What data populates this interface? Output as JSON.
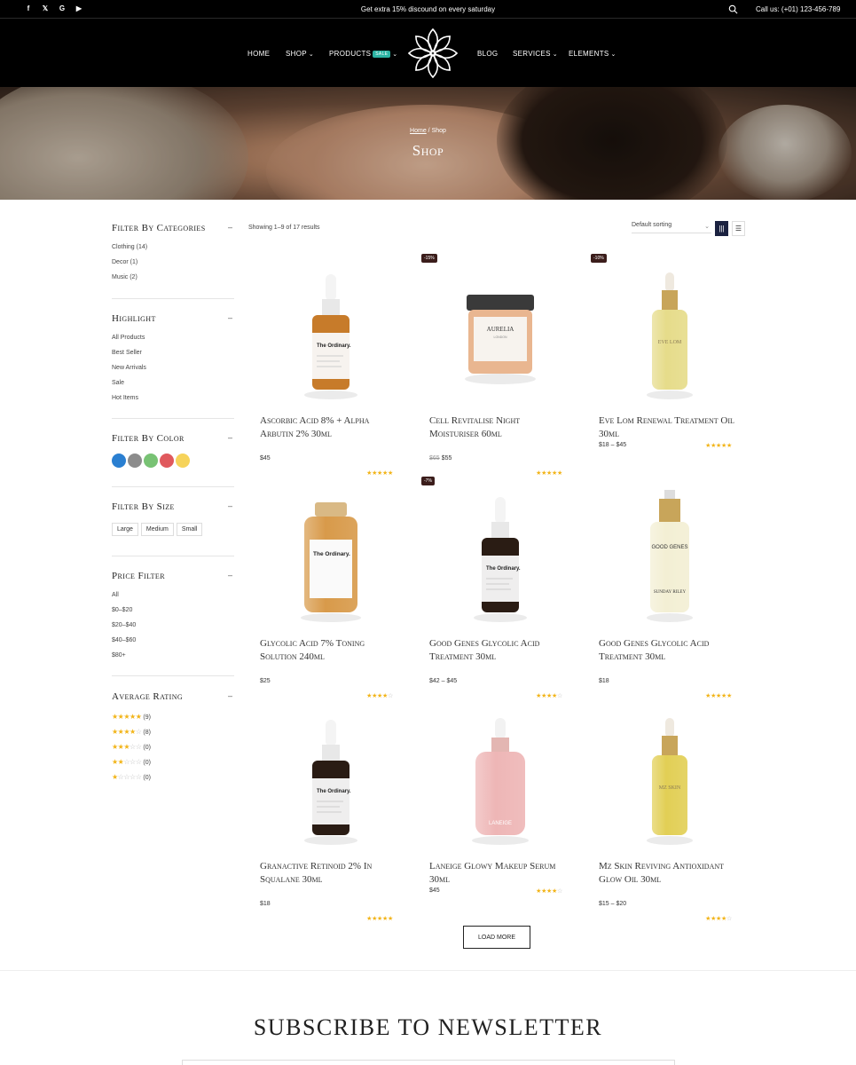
{
  "topbar": {
    "promo": "Get extra 15% discound on every saturday",
    "call": "Call us: (+01) 123-456-789",
    "socials": [
      {
        "icon": "facebook-icon",
        "glyph": "f"
      },
      {
        "icon": "x-icon",
        "glyph": "𝕏"
      },
      {
        "icon": "google-icon",
        "glyph": "G"
      },
      {
        "icon": "youtube-icon",
        "glyph": "▶"
      }
    ]
  },
  "nav": {
    "home": "HOME",
    "shop": "SHOP",
    "products": "PRODUCTS",
    "sale_badge": "SALE",
    "blog": "BLOG",
    "services": "SERVICES",
    "elements": "ELEMENTS"
  },
  "hero": {
    "breadcrumb_home": "Home",
    "breadcrumb_sep": " / ",
    "breadcrumb_current": "Shop",
    "title": "Shop"
  },
  "sidebar": {
    "categories": {
      "title": "Filter By Categories",
      "toggle": "–",
      "items": [
        "Clothing (14)",
        "Decor (1)",
        "Music (2)"
      ]
    },
    "highlight": {
      "title": "Highlight",
      "toggle": "–",
      "items": [
        "All Products",
        "Best Seller",
        "New Arrivals",
        "Sale",
        "Hot Items"
      ]
    },
    "color": {
      "title": "Filter By Color",
      "toggle": "–",
      "swatches": [
        "#2a7fd1",
        "#8c8c8c",
        "#78c274",
        "#e0595d",
        "#f6d35a"
      ]
    },
    "size": {
      "title": "Filter By Size",
      "toggle": "–",
      "items": [
        "Large",
        "Medium",
        "Small"
      ]
    },
    "price": {
      "title": "Price Filter",
      "toggle": "–",
      "items": [
        "All",
        "$0–$20",
        "$20–$40",
        "$40–$60",
        "$80+"
      ]
    },
    "rating": {
      "title": "Average Rating",
      "toggle": "–",
      "items": [
        {
          "stars": 5,
          "count": "(9)"
        },
        {
          "stars": 4,
          "count": "(8)"
        },
        {
          "stars": 3,
          "count": "(0)"
        },
        {
          "stars": 2,
          "count": "(0)"
        },
        {
          "stars": 1,
          "count": "(0)"
        }
      ]
    }
  },
  "toolbar": {
    "showing": "Showing 1–9 of 17 results",
    "sort": "Default sorting"
  },
  "products": [
    {
      "title": "Ascorbic Acid 8% + Alpha Arbutin 2% 30ml",
      "price": "$45",
      "old_price": "",
      "badge": "",
      "rating": 5
    },
    {
      "title": "Cell Revitalise Night Moisturiser 60ml",
      "price": "$55",
      "old_price": "$65",
      "badge": "-15%",
      "rating": 5
    },
    {
      "title": "Eve Lom Renewal Treatment Oil 30ml",
      "price": "$18 – $45",
      "old_price": "",
      "badge": "-10%",
      "rating": 5
    },
    {
      "title": "Glycolic Acid 7% Toning Solution 240ml",
      "price": "$25",
      "old_price": "",
      "badge": "",
      "rating": 4
    },
    {
      "title": "Good Genes Glycolic Acid Treatment 30ml",
      "price": "$42 – $45",
      "old_price": "",
      "badge": "-7%",
      "rating": 4
    },
    {
      "title": "Good Genes Glycolic Acid Treatment 30ml",
      "price": "$18",
      "old_price": "",
      "badge": "",
      "rating": 5
    },
    {
      "title": "Granactive Retinoid 2% In Squalane 30ml",
      "price": "$18",
      "old_price": "",
      "badge": "",
      "rating": 5
    },
    {
      "title": "Laneige Glowy Makeup Serum 30ml",
      "price": "$45",
      "old_price": "",
      "badge": "",
      "rating": 4
    },
    {
      "title": "Mz Skin Reviving Antioxidant Glow Oil 30ml",
      "price": "$15 – $20",
      "old_price": "",
      "badge": "",
      "rating": 4
    }
  ],
  "product_labels": {
    "ordinary": "The Ordinary.",
    "aurelia": "AURELIA",
    "aurelia_sub": "LONDON",
    "evelom": "EVE LOM",
    "goodgenes": "GOOD GENES",
    "sundayriley": "SUNDAY RILEY",
    "laneige": "LANEIGE",
    "mzskin": "MZ SKIN"
  },
  "load_more": "LOAD MORE",
  "newsletter": {
    "title": "SUBSCRIBE TO NEWSLETTER"
  },
  "colors": {
    "accent": "#1b2240",
    "star": "#f2b418",
    "sale": "#2bb3a3",
    "badge": "#3b1d1b"
  }
}
